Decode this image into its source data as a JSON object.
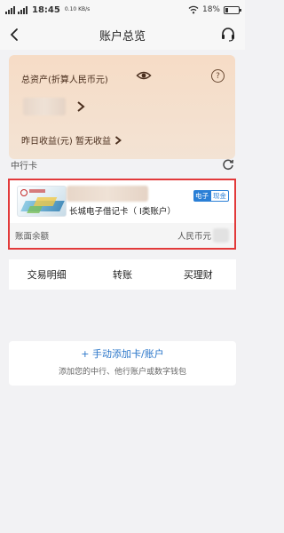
{
  "status_bar": {
    "time": "18:45",
    "network_speed": "0.10 KB/s",
    "battery": "18%",
    "battery_level": 0.18
  },
  "nav": {
    "title": "账户总览"
  },
  "assets": {
    "total_label": "总资产(折算人民币元)",
    "help": "?",
    "yesterday_label": "昨日收益(元) 暂无收益"
  },
  "section": {
    "title": "中行卡"
  },
  "card": {
    "badge_electronic": "电子",
    "badge_cash": "现金",
    "name": "长城电子借记卡（ I类账户）",
    "balance_label": "账面余额",
    "currency": "人民币元"
  },
  "actions": [
    "交易明细",
    "转账",
    "买理财"
  ],
  "add_account": {
    "title": "+ 手动添加卡/账户",
    "description": "添加您的中行、他行账户或数字钱包"
  },
  "colors": {
    "asset_card_bg": "#f6dcc6",
    "highlight_border": "#e23a3a",
    "link_blue": "#2a76c9"
  }
}
